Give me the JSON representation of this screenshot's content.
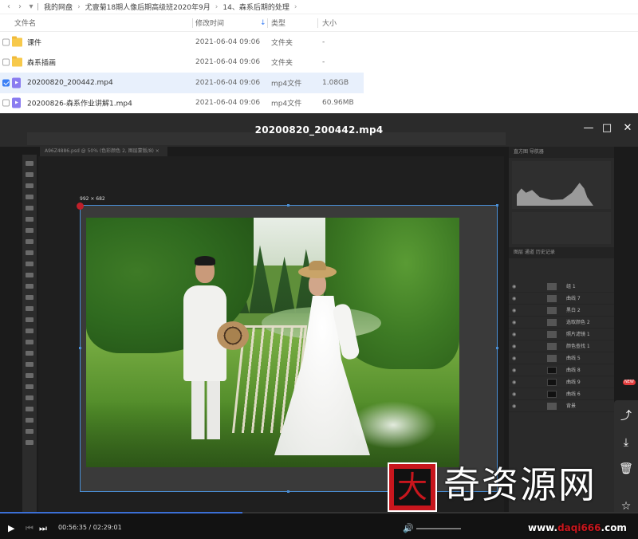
{
  "breadcrumb": [
    "我的网盘",
    "尤壹菊18期人像后期高级班2020年9月",
    "14、森系后期的处理"
  ],
  "columns": {
    "name": "文件名",
    "modified": "修改时间",
    "type": "类型",
    "size": "大小"
  },
  "files": [
    {
      "name": "课件",
      "modified": "2021-06-04 09:06",
      "type": "文件夹",
      "size": "-",
      "icon": "folder-icon",
      "checked": false
    },
    {
      "name": "森系插画",
      "modified": "2021-06-04 09:06",
      "type": "文件夹",
      "size": "-",
      "icon": "folder-icon",
      "checked": false
    },
    {
      "name": "20200820_200442.mp4",
      "modified": "2021-06-04 09:06",
      "type": "mp4文件",
      "size": "1.08GB",
      "icon": "video-file-icon",
      "checked": true
    },
    {
      "name": "20200826-森系作业讲解1.mp4",
      "modified": "2021-06-04 09:06",
      "type": "mp4文件",
      "size": "60.96MB",
      "icon": "video-file-icon",
      "checked": false
    }
  ],
  "player": {
    "title": "20200820_200442.mp4",
    "current_time": "00:56:35",
    "total_time": "02:29:01",
    "time_separator": "/",
    "progress": 0.38,
    "new_badge": "NEW"
  },
  "photoshop": {
    "doc_tab": "A96Z4886.psd @ 50% (色彩颜色 2, 图层蒙版/8) ×",
    "dimensions": "992 × 682",
    "panel_tabs": "直方图  导航器",
    "layers_tabs": "图层  通道  历史记录",
    "layers": [
      "组 1",
      "曲线 7",
      "黑白 2",
      "选取颜色 2",
      "照片滤镜 1",
      "颜色查找 1",
      "曲线 5",
      "曲线 8",
      "曲线 9",
      "曲线 6",
      "背景"
    ]
  },
  "watermark": {
    "logo_char": "大",
    "text": "奇资源网",
    "url_prefix": "www.",
    "url_main": "daqi666",
    "url_suffix": ".com"
  },
  "colors": {
    "accent": "#3b7ff5",
    "player_bg": "#1b1b1b",
    "watermark_red": "#c8161d"
  }
}
